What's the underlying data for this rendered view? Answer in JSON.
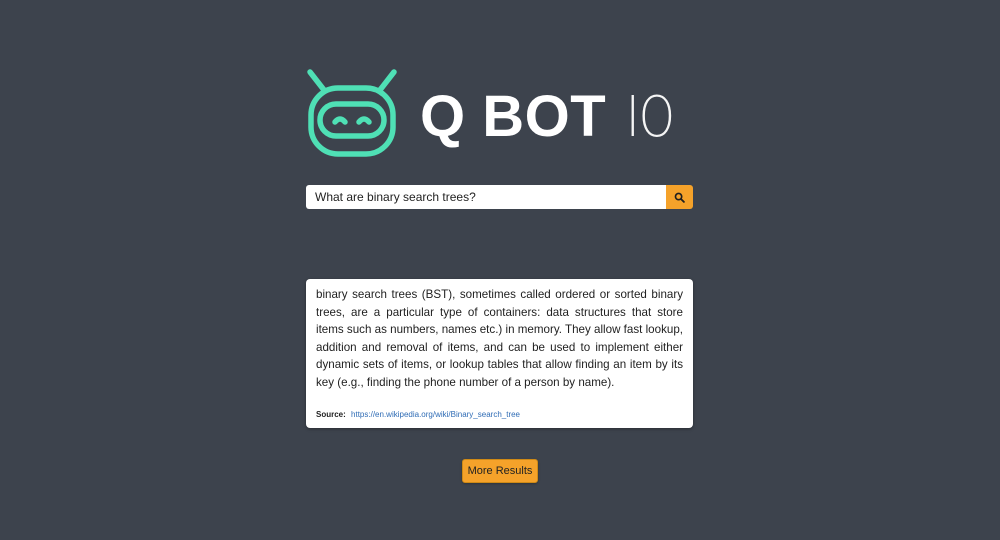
{
  "logo": {
    "icon": "robot-icon",
    "title_bold": "Q BOT",
    "title_light": "IO",
    "accent_color": "#4fe0b5"
  },
  "search": {
    "value": "What are binary search trees?",
    "button_icon": "search-icon",
    "button_color": "#f5a22a"
  },
  "result": {
    "text": "binary search trees (BST), sometimes called ordered or sorted binary trees, are a particular type of containers: data structures that store items such as numbers, names etc.) in memory. They allow fast lookup, addition and removal of items, and can be used to implement either dynamic sets of items, or lookup tables that allow finding an item by its key (e.g., finding the phone number of a person by name).",
    "source_label": "Source:",
    "source_url": "https://en.wikipedia.org/wiki/Binary_search_tree"
  },
  "more_results": {
    "label": "More Results"
  },
  "colors": {
    "background": "#3d434d",
    "accent": "#f5a22a",
    "link": "#2f6cb5"
  }
}
